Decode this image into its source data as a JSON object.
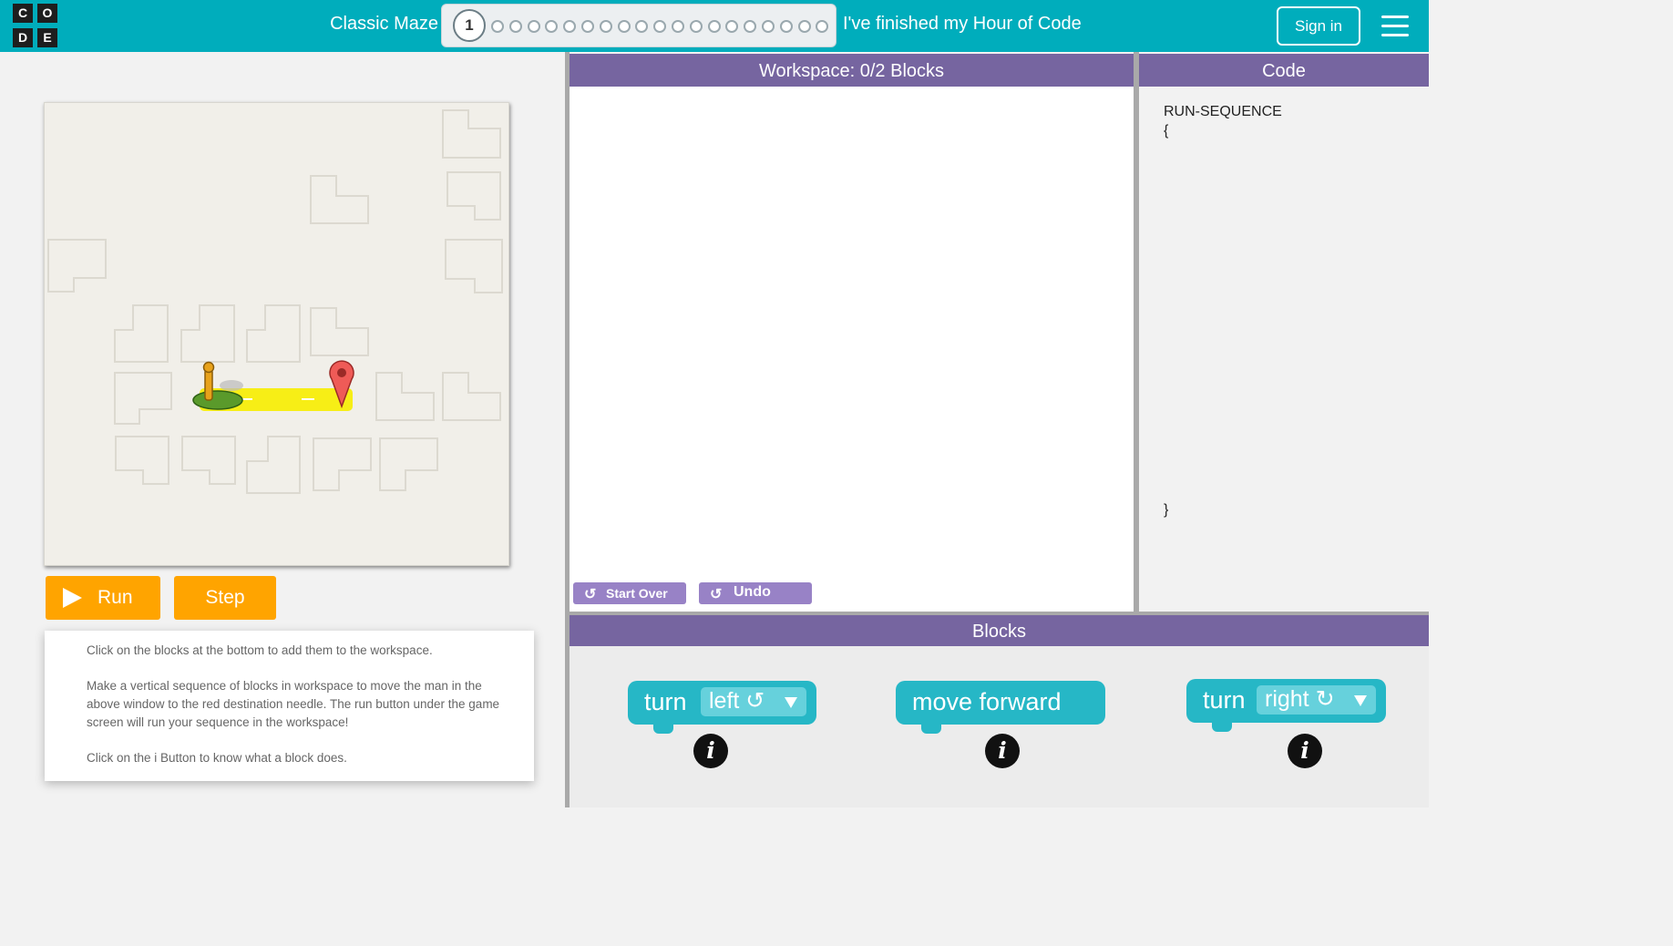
{
  "header": {
    "logo_letters": [
      "C",
      "O",
      "D",
      "E"
    ],
    "level_title": "Classic Maze",
    "current_level": "1",
    "total_dots": 19,
    "finished_link": "I've finished my Hour of Code",
    "signin_label": "Sign in",
    "menu_icon": "hamburger-icon",
    "brand_color": "#00adbc"
  },
  "game": {
    "run_label": "Run",
    "step_label": "Step",
    "button_color": "#ffa400",
    "instructions": [
      "Click on the blocks at the bottom to add them to the workspace.",
      "Make a vertical sequence of blocks in workspace to move the man in the above window to the red destination needle. The run button under the game screen will run your sequence in the workspace!",
      "Click on the i Button to know what a block does."
    ]
  },
  "workspace": {
    "title": "Workspace: 0/2 Blocks",
    "start_over_label": "Start Over",
    "undo_label": "Undo",
    "header_color": "#7665a0"
  },
  "code": {
    "title": "Code",
    "line1": "RUN-SEQUENCE",
    "open_brace": "{",
    "close_brace": "}"
  },
  "blocks": {
    "title": "Blocks",
    "items": [
      {
        "verb": "turn",
        "option": "left ↺"
      },
      {
        "verb": "move forward"
      },
      {
        "verb": "turn",
        "option": "right ↻"
      }
    ],
    "info_label": "i",
    "block_color": "#26b7c6"
  }
}
